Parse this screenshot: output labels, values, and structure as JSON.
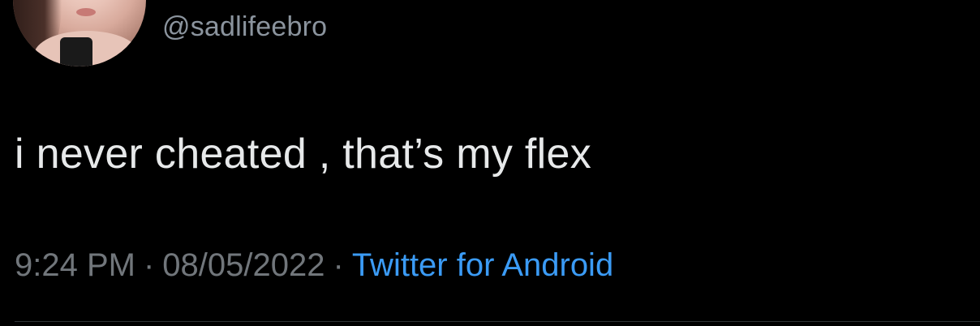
{
  "user": {
    "handle": "@sadlifeebro"
  },
  "tweet": {
    "text": "i never cheated , that’s my flex"
  },
  "meta": {
    "time": "9:24 PM",
    "separator": "·",
    "date": "08/05/2022",
    "source": "Twitter for Android"
  },
  "colors": {
    "background": "#000000",
    "text": "#e7e9ea",
    "muted": "#71767b",
    "link": "#3b9bf5"
  }
}
